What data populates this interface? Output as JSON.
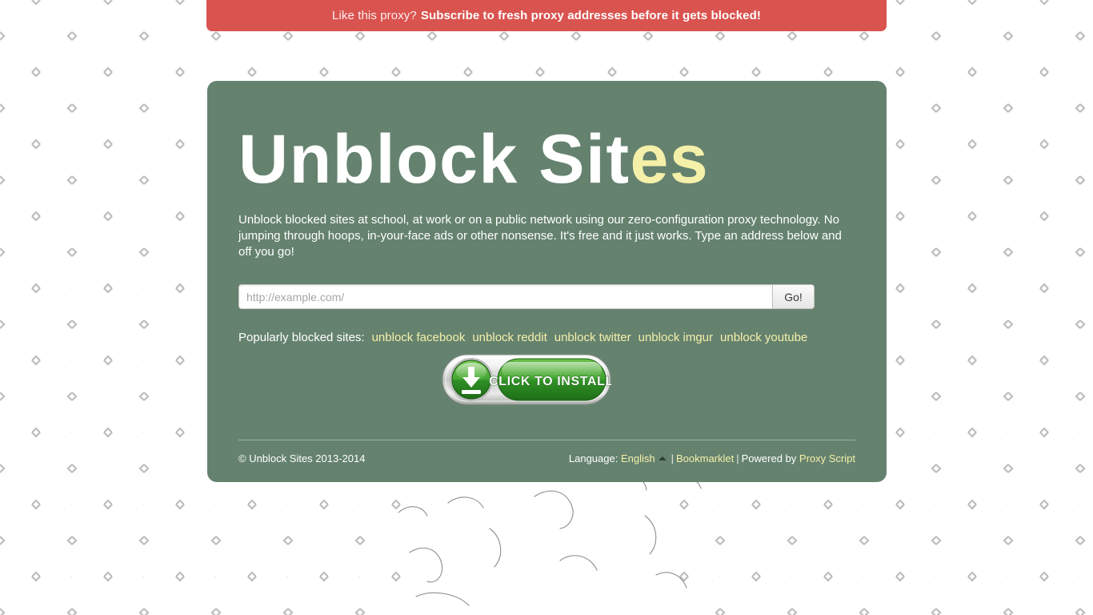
{
  "banner": {
    "lead_text": "Like this proxy?",
    "cta_text": "Subscribe to fresh proxy addresses before it gets blocked!",
    "background_color": "#d9534f"
  },
  "card": {
    "background_color": "#65826f",
    "brand_main": "Unblock Sit",
    "brand_tail": "es",
    "accent_color": "#f5f0a9",
    "description": "Unblock blocked sites at school, at work or on a public network using our zero-configuration proxy technology. No jumping through hoops, in-your-face ads or other nonsense. It's free and it just works. Type an address below and off you go!"
  },
  "form": {
    "url_placeholder": "http://example.com/",
    "url_value": "",
    "submit_label": "Go!"
  },
  "popular": {
    "label": "Popularly blocked sites:",
    "links": [
      {
        "label": "unblock facebook"
      },
      {
        "label": "unblock reddit"
      },
      {
        "label": "unblock twitter"
      },
      {
        "label": "unblock imgur"
      },
      {
        "label": "unblock youtube"
      }
    ]
  },
  "install": {
    "button_text": "CLICK TO INSTALL",
    "icon": "download-icon",
    "green_color": "#3f9e32",
    "chrome_color": "#d2d4d3"
  },
  "footer": {
    "copyright": "© Unblock Sites 2013-2014",
    "language_label": "Language:",
    "language_value": "English",
    "language_caret": "caret-up-icon",
    "separator": "|",
    "bookmarklet_label": "Bookmarklet",
    "powered_by_label": "Powered by",
    "proxy_script_label": "Proxy Script"
  },
  "background": {
    "pattern": "chain-link-fence",
    "line_color": "#9a9a9a",
    "fill_color": "#ffffff"
  }
}
